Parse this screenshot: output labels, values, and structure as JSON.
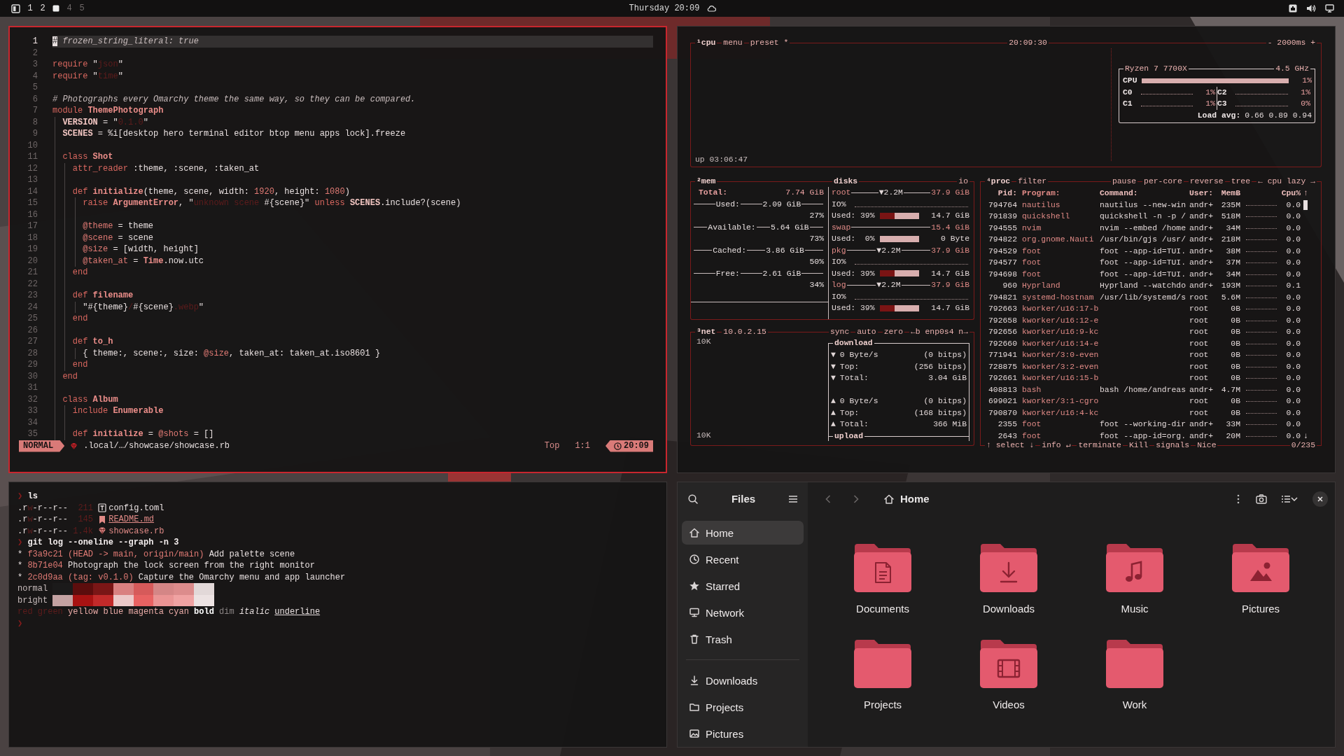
{
  "topbar": {
    "workspaces": [
      {
        "label": "1",
        "selected": false,
        "occupied": true
      },
      {
        "label": "2",
        "selected": false,
        "occupied": true
      },
      {
        "selected": true
      },
      {
        "label": "4",
        "selected": false,
        "occupied": false
      },
      {
        "label": "5",
        "selected": false,
        "occupied": false
      }
    ],
    "clock": "Thursday 20:09"
  },
  "editor": {
    "focused": true,
    "lines": [
      {
        "number": "1",
        "current": true,
        "tokens": [
          {
            "kind": "cursor",
            "text": "#"
          },
          {
            "kind": "comment",
            "text": " frozen_string_literal: true"
          }
        ]
      },
      {
        "number": "2",
        "current": false
      },
      {
        "number": "3",
        "current": false,
        "tokens": [
          {
            "kind": "kw",
            "text": "require"
          },
          {
            "kind": "plain",
            "text": " \""
          },
          {
            "kind": "str",
            "text": "json"
          },
          {
            "kind": "plain",
            "text": "\""
          }
        ]
      },
      {
        "number": "4",
        "current": false,
        "tokens": [
          {
            "kind": "kw",
            "text": "require"
          },
          {
            "kind": "plain",
            "text": " \""
          },
          {
            "kind": "str",
            "text": "time"
          },
          {
            "kind": "plain",
            "text": "\""
          }
        ]
      },
      {
        "number": "5",
        "current": false
      },
      {
        "number": "6",
        "current": false,
        "tokens": [
          {
            "kind": "comment",
            "text": "# Photographs every Omarchy theme the same way, so they can be compared."
          }
        ]
      },
      {
        "number": "7",
        "current": false,
        "tokens": [
          {
            "kind": "kw",
            "text": "module "
          },
          {
            "kind": "def",
            "text": "ThemePhotograph"
          }
        ]
      },
      {
        "number": "8",
        "current": false,
        "tokens": [
          {
            "kind": "const",
            "text": "  VERSION"
          },
          {
            "kind": "plain",
            "text": " = \""
          },
          {
            "kind": "str",
            "text": "0.1.0"
          },
          {
            "kind": "plain",
            "text": "\""
          }
        ]
      },
      {
        "number": "9",
        "current": false,
        "tokens": [
          {
            "kind": "const",
            "text": "  SCENES"
          },
          {
            "kind": "plain",
            "text": " = %i[desktop hero terminal editor btop menu apps lock].freeze"
          }
        ]
      },
      {
        "number": "10",
        "current": false
      },
      {
        "number": "11",
        "current": false,
        "tokens": [
          {
            "kind": "kw",
            "text": "  class "
          },
          {
            "kind": "def",
            "text": "Shot"
          }
        ]
      },
      {
        "number": "12",
        "current": false,
        "tokens": [
          {
            "kind": "kw",
            "text": "    attr_reader"
          },
          {
            "kind": "plain",
            "text": " :theme, :scene, :taken_at"
          }
        ]
      },
      {
        "number": "13",
        "current": false
      },
      {
        "number": "14",
        "current": false,
        "tokens": [
          {
            "kind": "kw",
            "text": "    def "
          },
          {
            "kind": "def",
            "text": "initialize"
          },
          {
            "kind": "plain",
            "text": "(theme, scene, width: "
          },
          {
            "kind": "num",
            "text": "1920"
          },
          {
            "kind": "plain",
            "text": ", height: "
          },
          {
            "kind": "num",
            "text": "1080"
          },
          {
            "kind": "plain",
            "text": ")"
          }
        ]
      },
      {
        "number": "15",
        "current": false,
        "tokens": [
          {
            "kind": "kw",
            "text": "      raise "
          },
          {
            "kind": "def",
            "text": "ArgumentError"
          },
          {
            "kind": "plain",
            "text": ", \""
          },
          {
            "kind": "str",
            "text": "unknown scene"
          },
          {
            "kind": "plain",
            "text": " #{scene}\" "
          },
          {
            "kind": "kw",
            "text": "unless "
          },
          {
            "kind": "const",
            "text": "SCENES"
          },
          {
            "kind": "plain",
            "text": ".include?(scene)"
          }
        ]
      },
      {
        "number": "16",
        "current": false
      },
      {
        "number": "17",
        "current": false,
        "tokens": [
          {
            "kind": "ivar",
            "text": "      @theme"
          },
          {
            "kind": "plain",
            "text": " = theme"
          }
        ]
      },
      {
        "number": "18",
        "current": false,
        "tokens": [
          {
            "kind": "ivar",
            "text": "      @scene"
          },
          {
            "kind": "plain",
            "text": " = scene"
          }
        ]
      },
      {
        "number": "19",
        "current": false,
        "tokens": [
          {
            "kind": "ivar",
            "text": "      @size"
          },
          {
            "kind": "plain",
            "text": " = [width, height]"
          }
        ]
      },
      {
        "number": "20",
        "current": false,
        "tokens": [
          {
            "kind": "ivar",
            "text": "      @taken_at"
          },
          {
            "kind": "plain",
            "text": " = "
          },
          {
            "kind": "def",
            "text": "Time"
          },
          {
            "kind": "plain",
            "text": ".now.utc"
          }
        ]
      },
      {
        "number": "21",
        "current": false,
        "tokens": [
          {
            "kind": "kw",
            "text": "    end"
          }
        ]
      },
      {
        "number": "22",
        "current": false
      },
      {
        "number": "23",
        "current": false,
        "tokens": [
          {
            "kind": "kw",
            "text": "    def "
          },
          {
            "kind": "def",
            "text": "filename"
          }
        ]
      },
      {
        "number": "24",
        "current": false,
        "tokens": [
          {
            "kind": "plain",
            "text": "      \"#{theme}"
          },
          {
            "kind": "str",
            "text": "/"
          },
          {
            "kind": "plain",
            "text": "#{scene}"
          },
          {
            "kind": "str",
            "text": ".webp"
          },
          {
            "kind": "plain",
            "text": "\""
          }
        ]
      },
      {
        "number": "25",
        "current": false,
        "tokens": [
          {
            "kind": "kw",
            "text": "    end"
          }
        ]
      },
      {
        "number": "26",
        "current": false
      },
      {
        "number": "27",
        "current": false,
        "tokens": [
          {
            "kind": "kw",
            "text": "    def "
          },
          {
            "kind": "def",
            "text": "to_h"
          }
        ]
      },
      {
        "number": "28",
        "current": false,
        "tokens": [
          {
            "kind": "plain",
            "text": "      { theme:, scene:, size: "
          },
          {
            "kind": "ivar",
            "text": "@size"
          },
          {
            "kind": "plain",
            "text": ", taken_at: taken_at.iso8601 }"
          }
        ]
      },
      {
        "number": "29",
        "current": false,
        "tokens": [
          {
            "kind": "kw",
            "text": "    end"
          }
        ]
      },
      {
        "number": "30",
        "current": false,
        "tokens": [
          {
            "kind": "kw",
            "text": "  end"
          }
        ]
      },
      {
        "number": "31",
        "current": false
      },
      {
        "number": "32",
        "current": false,
        "tokens": [
          {
            "kind": "kw",
            "text": "  class "
          },
          {
            "kind": "def",
            "text": "Album"
          }
        ]
      },
      {
        "number": "33",
        "current": false,
        "tokens": [
          {
            "kind": "kw",
            "text": "    include "
          },
          {
            "kind": "def",
            "text": "Enumerable"
          }
        ]
      },
      {
        "number": "34",
        "current": false
      },
      {
        "number": "35",
        "current": false,
        "tokens": [
          {
            "kind": "kw",
            "text": "    def "
          },
          {
            "kind": "def",
            "text": "initialize"
          },
          {
            "kind": "plain",
            "text": " = "
          },
          {
            "kind": "ivar",
            "text": "@shots"
          },
          {
            "kind": "plain",
            "text": " = []"
          }
        ]
      }
    ],
    "status": {
      "mode": "NORMAL",
      "path": ".local/…/showcase/showcase.rb",
      "position": "Top",
      "cursor": "1:1",
      "clock": "20:09"
    }
  },
  "btop": {
    "focused": false,
    "cpu": {
      "tabs": [
        "¹cpu",
        "menu",
        "preset *"
      ],
      "clock": "20:09:30",
      "interval": "- 2000ms +",
      "uptime": "up 03:06:47",
      "model": "Ryzen 7 7700X",
      "frequency": "4.5 GHz",
      "total": {
        "label": "CPU",
        "value": "1%"
      },
      "cores": [
        {
          "label": "C0",
          "value": "1%"
        },
        {
          "label": "C2",
          "value": "1%"
        },
        {
          "label": "C1",
          "value": "1%"
        },
        {
          "label": "C3",
          "value": "0%"
        }
      ],
      "load_label": "Load avg:",
      "load_values": "0.66 0.89 0.94"
    },
    "mem": {
      "title": "²mem",
      "rows": [
        {
          "kind": "total",
          "label": "Total:",
          "value": "7.74 GiB"
        },
        {
          "kind": "line",
          "label": "Used:",
          "value": "2.09 GiB",
          "percent": "27%"
        },
        {
          "kind": "line",
          "label": "Available:",
          "value": "5.64 GiB",
          "percent": "73%"
        },
        {
          "kind": "line",
          "label": "Cached:",
          "value": "3.86 GiB",
          "percent": "50%"
        },
        {
          "kind": "line",
          "label": "Free:",
          "value": "2.61 GiB",
          "percent": "34%"
        }
      ]
    },
    "disks": {
      "title": "disks",
      "io_title": "io",
      "items": [
        {
          "name": "root",
          "io": "▼2.2M",
          "size": "37.9 GiB",
          "io_label": "IO%",
          "used_label": "Used:",
          "used_percent": "39%",
          "level": 0.39,
          "used": "14.7 GiB"
        },
        {
          "name": "swap",
          "size": "15.4 GiB",
          "used_label": "Used:",
          "used_percent": "0%",
          "level": 0,
          "used": "0 Byte"
        },
        {
          "name": "pkg",
          "io": "▼2.2M",
          "size": "37.9 GiB",
          "io_label": "IO%",
          "used_label": "Used:",
          "used_percent": "39%",
          "level": 0.39,
          "used": "14.7 GiB"
        },
        {
          "name": "log",
          "io": "▼2.2M",
          "size": "37.9 GiB",
          "io_label": "IO%",
          "used_label": "Used:",
          "used_percent": "39%",
          "level": 0.39,
          "used": "14.7 GiB"
        }
      ]
    },
    "net": {
      "tabs": [
        "³net",
        "10.0.2.15"
      ],
      "options": [
        "sync",
        "auto",
        "zero",
        "←b enp0s4 n→"
      ],
      "scale_top": "10K",
      "scale_bottom": "10K",
      "download_title": "download",
      "upload_title": "upload",
      "download_rows": [
        {
          "arrow": "▼",
          "label": "0 Byte/s",
          "value": "(0 bitps)"
        },
        {
          "arrow": "▼",
          "label": "Top:",
          "value": "(256 bitps)"
        },
        {
          "arrow": "▼",
          "label": "Total:",
          "value": "3.04 GiB"
        }
      ],
      "upload_rows": [
        {
          "arrow": "▲",
          "label": "0 Byte/s",
          "value": "(0 bitps)"
        },
        {
          "arrow": "▲",
          "label": "Top:",
          "value": "(168 bitps)"
        },
        {
          "arrow": "▲",
          "label": "Total:",
          "value": "366 MiB"
        }
      ]
    },
    "proc": {
      "tabs": [
        "⁴proc",
        "filter"
      ],
      "options": [
        "pause",
        "per-core",
        "reverse",
        "tree",
        "← cpu lazy →"
      ],
      "columns": [
        "Pid:",
        "Program:",
        "Command:",
        "User:",
        "MemB",
        "Cpu%"
      ],
      "scroll_up": "↑",
      "scroll_down": "↓",
      "rows": [
        {
          "pid": "794764",
          "program": "nautilus",
          "command": "nautilus --new-win",
          "user": "andr+",
          "mem": "235M",
          "cpu": "0.0"
        },
        {
          "pid": "791839",
          "program": "quickshell",
          "command": "quickshell -n -p /",
          "user": "andr+",
          "mem": "518M",
          "cpu": "0.0"
        },
        {
          "pid": "794555",
          "program": "nvim",
          "command": "nvim --embed /home",
          "user": "andr+",
          "mem": "34M",
          "cpu": "0.0"
        },
        {
          "pid": "794822",
          "program": "org.gnome.Nauti",
          "command": "/usr/bin/gjs /usr/",
          "user": "andr+",
          "mem": "218M",
          "cpu": "0.0"
        },
        {
          "pid": "794529",
          "program": "foot",
          "command": "foot --app-id=TUI.",
          "user": "andr+",
          "mem": "38M",
          "cpu": "0.0"
        },
        {
          "pid": "794577",
          "program": "foot",
          "command": "foot --app-id=TUI.",
          "user": "andr+",
          "mem": "37M",
          "cpu": "0.0"
        },
        {
          "pid": "794698",
          "program": "foot",
          "command": "foot --app-id=TUI.",
          "user": "andr+",
          "mem": "34M",
          "cpu": "0.0"
        },
        {
          "pid": "960",
          "program": "Hyprland",
          "command": "Hyprland --watchdo",
          "user": "andr+",
          "mem": "193M",
          "cpu": "0.1"
        },
        {
          "pid": "794821",
          "program": "systemd-hostnam",
          "command": "/usr/lib/systemd/s",
          "user": "root",
          "mem": "5.6M",
          "cpu": "0.0"
        },
        {
          "pid": "792663",
          "program": "kworker/u16:17-b",
          "user": "root",
          "mem": "0B",
          "cpu": "0.0"
        },
        {
          "pid": "792658",
          "program": "kworker/u16:12-e",
          "user": "root",
          "mem": "0B",
          "cpu": "0.0"
        },
        {
          "pid": "792656",
          "program": "kworker/u16:9-kc",
          "user": "root",
          "mem": "0B",
          "cpu": "0.0"
        },
        {
          "pid": "792660",
          "program": "kworker/u16:14-e",
          "user": "root",
          "mem": "0B",
          "cpu": "0.0"
        },
        {
          "pid": "771941",
          "program": "kworker/3:0-even",
          "user": "root",
          "mem": "0B",
          "cpu": "0.0"
        },
        {
          "pid": "728875",
          "program": "kworker/3:2-even",
          "user": "root",
          "mem": "0B",
          "cpu": "0.0"
        },
        {
          "pid": "792661",
          "program": "kworker/u16:15-b",
          "user": "root",
          "mem": "0B",
          "cpu": "0.0"
        },
        {
          "pid": "408813",
          "program": "bash",
          "command": "bash /home/andreas",
          "user": "andr+",
          "mem": "4.7M",
          "cpu": "0.0"
        },
        {
          "pid": "699021",
          "program": "kworker/3:1-cgro",
          "user": "root",
          "mem": "0B",
          "cpu": "0.0"
        },
        {
          "pid": "790870",
          "program": "kworker/u16:4-kc",
          "user": "root",
          "mem": "0B",
          "cpu": "0.0"
        },
        {
          "pid": "2355",
          "program": "foot",
          "command": "foot --working-dir",
          "user": "andr+",
          "mem": "33M",
          "cpu": "0.0"
        },
        {
          "pid": "2643",
          "program": "foot",
          "command": "foot --app-id=org.",
          "user": "andr+",
          "mem": "20M",
          "cpu": "0.0"
        }
      ],
      "footer": [
        "↑ select ↓",
        "info ↵",
        "terminate",
        "Kill",
        "signals",
        "Nice"
      ],
      "count": "0/235"
    }
  },
  "terminal": {
    "focused": false,
    "lines": [
      {
        "kind": "text",
        "tokens": [
          {
            "kind": "prompt",
            "text": "❯"
          },
          {
            "kind": "cmd",
            "text": " ls"
          }
        ]
      },
      {
        "kind": "toml",
        "perm": [
          {
            "kind": "plain",
            "text": ".r"
          },
          {
            "kind": "dim",
            "text": "w"
          },
          {
            "kind": "plain",
            "text": "-r--r--"
          }
        ],
        "size": "211",
        "name": "config.toml"
      },
      {
        "kind": "markdown",
        "perm": [
          {
            "kind": "plain",
            "text": ".r"
          },
          {
            "kind": "dim",
            "text": "w"
          },
          {
            "kind": "plain",
            "text": "-r--r--"
          }
        ],
        "size": "145",
        "name": "README.md"
      },
      {
        "kind": "ruby",
        "perm": [
          {
            "kind": "plain",
            "text": ".r"
          },
          {
            "kind": "dim",
            "text": "w"
          },
          {
            "kind": "plain",
            "text": "-r--r--"
          }
        ],
        "size": "1.4k",
        "name": "showcase.rb"
      },
      {
        "kind": "text",
        "tokens": [
          {
            "kind": "prompt",
            "text": "❯"
          },
          {
            "kind": "cmd",
            "text": " git log --oneline --graph -n 3"
          }
        ]
      },
      {
        "kind": "text",
        "tokens": [
          {
            "kind": "plain",
            "text": "* "
          },
          {
            "kind": "hash",
            "text": "f3a9c21"
          },
          {
            "kind": "hash",
            "text": " (HEAD -> main, origin/main)"
          },
          {
            "kind": "plain",
            "text": " Add palette scene"
          }
        ]
      },
      {
        "kind": "text",
        "tokens": [
          {
            "kind": "plain",
            "text": "* "
          },
          {
            "kind": "hash",
            "text": "8b71e04"
          },
          {
            "kind": "plain",
            "text": " Photograph the lock screen from the right monitor"
          }
        ]
      },
      {
        "kind": "text",
        "tokens": [
          {
            "kind": "plain",
            "text": "* "
          },
          {
            "kind": "hash",
            "text": "2c0d9aa"
          },
          {
            "kind": "hash",
            "text": " (tag: v0.1.0)"
          },
          {
            "kind": "plain",
            "text": " Capture the Omarchy menu and app launcher"
          }
        ]
      },
      {
        "kind": "palette",
        "label": "normal",
        "swatches": [
          {
            "color": "#1b1a1a"
          },
          {
            "color": "#5c0d0d"
          },
          {
            "color": "#7a1616"
          },
          {
            "color": "#d98080"
          },
          {
            "color": "#d65a5a"
          },
          {
            "color": "#d48686"
          },
          {
            "color": "#dc8c8c"
          },
          {
            "color": "#e2d8d8"
          }
        ]
      },
      {
        "kind": "palette",
        "label": "bright",
        "swatches": [
          {
            "color": "#c4a2a2"
          },
          {
            "color": "#a81212"
          },
          {
            "color": "#c22a2a"
          },
          {
            "color": "#ecc8c8"
          },
          {
            "color": "#e86262"
          },
          {
            "color": "#ea9494"
          },
          {
            "color": "#f0a2a2"
          },
          {
            "color": "#ece2e2"
          }
        ]
      },
      {
        "kind": "text",
        "tokens": [
          {
            "kind": "dim",
            "text": "red"
          },
          {
            "kind": "dim",
            "text": " green"
          },
          {
            "kind": "accent",
            "text": " yellow blue magenta cyan"
          },
          {
            "kind": "bold",
            "text": " bold"
          },
          {
            "kind": "faint",
            "text": " dim"
          },
          {
            "kind": "italic",
            "text": " italic "
          },
          {
            "kind": "underline",
            "text": "underline"
          }
        ]
      },
      {
        "kind": "text",
        "tokens": [
          {
            "kind": "prompt",
            "text": "❯"
          }
        ]
      }
    ]
  },
  "files": {
    "focused": false,
    "title": "Files",
    "path": "Home",
    "places": [
      {
        "kind": "home",
        "label": "Home",
        "selected": true
      },
      {
        "kind": "recent",
        "label": "Recent",
        "selected": false
      },
      {
        "kind": "starred",
        "label": "Starred",
        "selected": false
      },
      {
        "kind": "network",
        "label": "Network",
        "selected": false
      },
      {
        "kind": "trash",
        "label": "Trash",
        "selected": false
      }
    ],
    "bookmarks": [
      {
        "kind": "downloads",
        "label": "Downloads",
        "selected": false
      },
      {
        "kind": "folder",
        "label": "Projects",
        "selected": false
      },
      {
        "kind": "pictures",
        "label": "Pictures",
        "selected": false
      }
    ],
    "folders": [
      {
        "kind": "documents",
        "name": "Documents"
      },
      {
        "kind": "downloads",
        "name": "Downloads"
      },
      {
        "kind": "music",
        "name": "Music"
      },
      {
        "kind": "pictures",
        "name": "Pictures"
      },
      {
        "kind": "plain",
        "name": "Projects"
      },
      {
        "kind": "videos",
        "name": "Videos"
      },
      {
        "kind": "plain",
        "name": "Work"
      }
    ]
  }
}
